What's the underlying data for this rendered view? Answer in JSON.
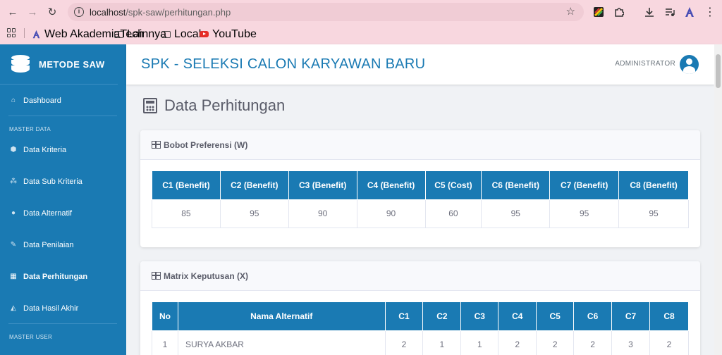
{
  "browser": {
    "url_host": "localhost",
    "url_path": "/spk-saw/perhitungan.php",
    "bookmarks": [
      "Web AkademiaTech",
      "Lainnya",
      "Local",
      "YouTube"
    ]
  },
  "sidebar": {
    "brand": "METODE SAW",
    "dashboard": "Dashboard",
    "section_master_data": "MASTER DATA",
    "items": [
      {
        "label": "Data Kriteria",
        "icon": "cube-icon"
      },
      {
        "label": "Data Sub Kriteria",
        "icon": "cubes-icon"
      },
      {
        "label": "Data Alternatif",
        "icon": "users-icon"
      },
      {
        "label": "Data Penilaian",
        "icon": "edit-icon"
      },
      {
        "label": "Data Perhitungan",
        "icon": "calculator-icon",
        "active": true
      },
      {
        "label": "Data Hasil Akhir",
        "icon": "chart-area-icon"
      }
    ],
    "section_master_user": "MASTER USER"
  },
  "header": {
    "title": "SPK - SELEKSI CALON KARYAWAN BARU",
    "user": "ADMINISTRATOR"
  },
  "page": {
    "title": "Data Perhitungan"
  },
  "bobot": {
    "title": "Bobot Preferensi (W)",
    "headers": [
      "C1 (Benefit)",
      "C2 (Benefit)",
      "C3 (Benefit)",
      "C4 (Benefit)",
      "C5 (Cost)",
      "C6 (Benefit)",
      "C7 (Benefit)",
      "C8 (Benefit)"
    ],
    "values": [
      "85",
      "95",
      "90",
      "90",
      "60",
      "95",
      "95",
      "95"
    ]
  },
  "matrix": {
    "title": "Matrix Keputusan (X)",
    "headers": [
      "No",
      "Nama Alternatif",
      "C1",
      "C2",
      "C3",
      "C4",
      "C5",
      "C6",
      "C7",
      "C8"
    ],
    "rows": [
      [
        "1",
        "SURYA AKBAR",
        "2",
        "1",
        "1",
        "2",
        "2",
        "2",
        "3",
        "2"
      ]
    ]
  }
}
